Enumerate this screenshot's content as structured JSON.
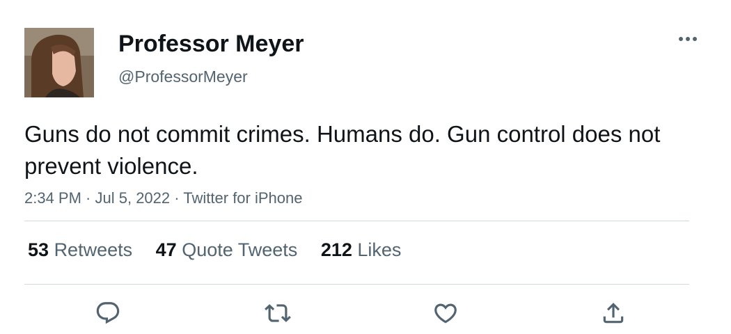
{
  "tweet": {
    "author": {
      "display_name": "Professor Meyer",
      "handle": "@ProfessorMeyer"
    },
    "text": "Guns do not commit crimes. Humans do. Gun control does not prevent violence.",
    "meta": {
      "time": "2:34 PM",
      "separator1": " · ",
      "date": "Jul 5, 2022",
      "separator2": " · ",
      "source": "Twitter for iPhone"
    },
    "stats": {
      "retweets": {
        "count": "53",
        "label": "Retweets"
      },
      "quote_tweets": {
        "count": "47",
        "label": "Quote Tweets"
      },
      "likes": {
        "count": "212",
        "label": "Likes"
      }
    },
    "actions": {
      "reply_icon": "reply-icon",
      "retweet_icon": "retweet-icon",
      "like_icon": "heart-icon",
      "share_icon": "share-icon"
    }
  },
  "colors": {
    "primary_text": "#0f1419",
    "secondary_text": "#536471",
    "divider": "#cfd9de"
  }
}
